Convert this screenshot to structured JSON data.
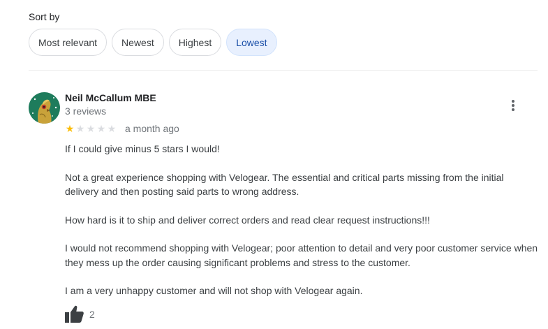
{
  "sort": {
    "label": "Sort by",
    "options": [
      {
        "label": "Most relevant",
        "selected": false
      },
      {
        "label": "Newest",
        "selected": false
      },
      {
        "label": "Highest",
        "selected": false
      },
      {
        "label": "Lowest",
        "selected": true
      }
    ]
  },
  "review": {
    "author": "Neil McCallum MBE",
    "review_count": "3 reviews",
    "rating": 1,
    "rating_max": 5,
    "date": "a month ago",
    "paragraphs": [
      "If I could give minus 5 stars I would!",
      "Not a great experience shopping with Velogear. The essential and critical parts missing from the initial delivery and then posting said parts to wrong address.",
      "How hard is it to ship and deliver correct orders and read clear request instructions!!!",
      "I would not recommend shopping with Velogear;  poor attention to detail and very poor customer service when they mess up the order causing significant problems and stress to the customer.",
      "I am a very unhappy customer and will not shop with Velogear again."
    ],
    "helpful_count": "2"
  },
  "icons": {
    "more": "more-vert-icon",
    "thumb": "thumb-up-icon",
    "star": "star-icon",
    "avatar": "avatar-image"
  },
  "colors": {
    "star_filled": "#fbbc04",
    "star_empty": "#dadce0",
    "selected_chip_bg": "#e8f0fe",
    "selected_chip_text": "#1a4fa8",
    "avatar_bg": "#1e7c5c"
  }
}
